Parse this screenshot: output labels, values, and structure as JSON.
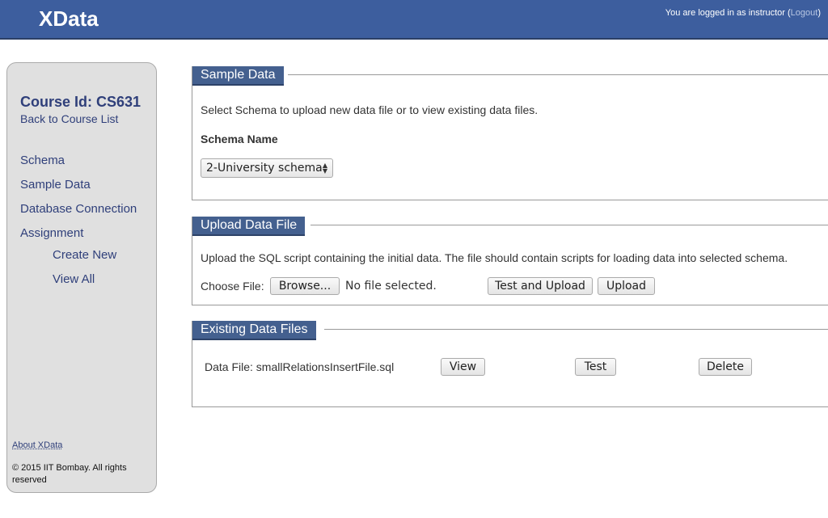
{
  "header": {
    "app_title": "XData",
    "login_prefix": "You are logged in as instructor (",
    "logout_label": "Logout",
    "login_suffix": ")"
  },
  "sidebar": {
    "course_id": "Course Id: CS631",
    "back_link": "Back to Course List",
    "items": [
      {
        "label": "Schema"
      },
      {
        "label": "Sample Data"
      },
      {
        "label": "Database Connection"
      },
      {
        "label": "Assignment"
      }
    ],
    "sub_items": [
      {
        "label": "Create New"
      },
      {
        "label": "View All"
      }
    ],
    "about_link": "About XData",
    "copyright": "© 2015 IIT Bombay. All rights reserved"
  },
  "sample_data": {
    "legend": "Sample Data",
    "description": "Select Schema to upload new data file or to view existing data files.",
    "schema_label": "Schema Name",
    "schema_selected": "2-University schema"
  },
  "upload": {
    "legend": "Upload Data File",
    "description": "Upload the SQL script containing the initial data. The file should contain scripts for loading data into selected schema.",
    "choose_file_label": "Choose File:",
    "browse_label": "Browse...",
    "file_status": "No file selected.",
    "test_upload_label": "Test and Upload",
    "upload_label": "Upload"
  },
  "existing": {
    "legend": "Existing Data Files",
    "file_text": "Data File: smallRelationsInsertFile.sql",
    "view_label": "View",
    "test_label": "Test",
    "delete_label": "Delete"
  }
}
